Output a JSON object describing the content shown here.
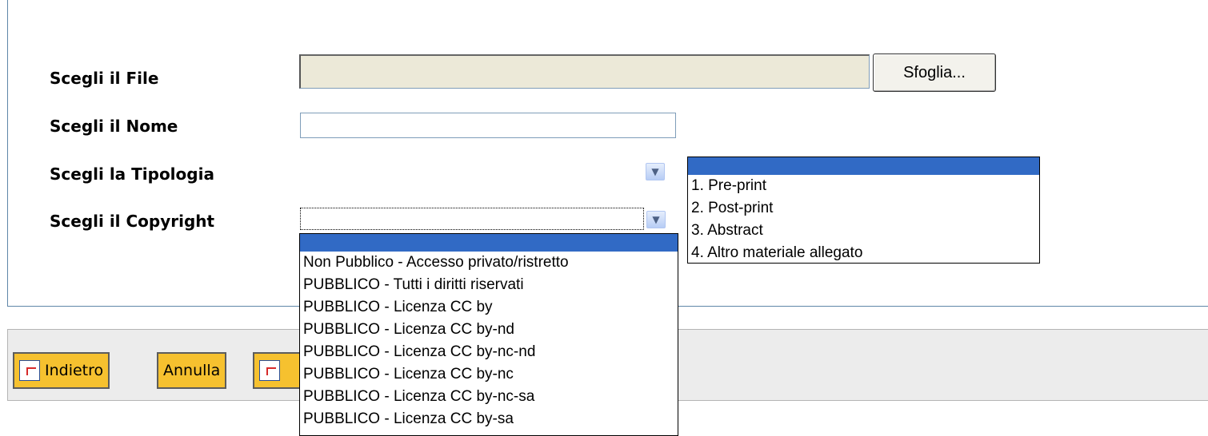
{
  "form": {
    "file_label": "Scegli il File",
    "name_label": "Scegli il Nome",
    "type_label": "Scegli la Tipologia",
    "copyright_label": "Scegli il Copyright",
    "browse_button": "Sfoglia...",
    "file_value": "",
    "name_value": ""
  },
  "tipologia_dropdown": {
    "selected": "",
    "options": [
      "",
      "1. Pre-print",
      "2. Post-print",
      "3. Abstract",
      "4. Altro materiale allegato"
    ]
  },
  "copyright_dropdown": {
    "selected": "",
    "options": [
      "",
      "Non Pubblico - Accesso privato/ristretto",
      "PUBBLICO - Tutti i diritti riservati",
      "PUBBLICO - Licenza CC by",
      "PUBBLICO - Licenza CC by-nd",
      "PUBBLICO - Licenza CC by-nc-nd",
      "PUBBLICO - Licenza CC by-nc",
      "PUBBLICO - Licenza CC by-nc-sa",
      "PUBBLICO - Licenza CC by-sa"
    ]
  },
  "toolbar": {
    "back_label": "Indietro",
    "cancel_label": "Annulla",
    "third_label": ""
  },
  "colors": {
    "highlight": "#316ac5",
    "toolbar_button": "#f6c12f",
    "panel_border": "#5f86a8"
  }
}
